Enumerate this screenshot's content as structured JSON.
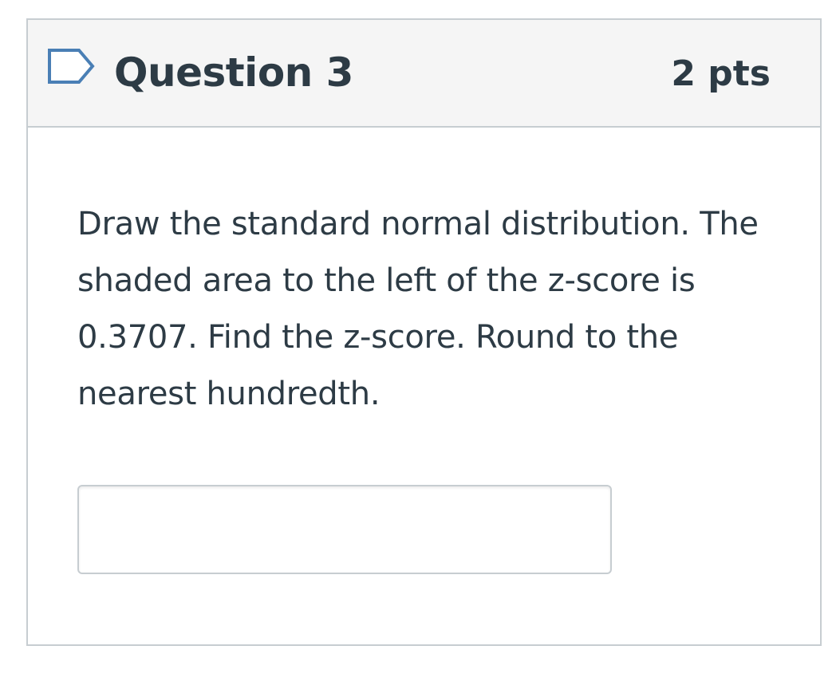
{
  "question": {
    "title": "Question 3",
    "points": "2 pts",
    "flag_icon": "bookmark-flag-icon",
    "text": "Draw the standard normal distribution. The shaded area to the left of the z-score is 0.3707. Find the z-score. Round to the nearest hundredth.",
    "answer_value": "",
    "colors": {
      "header_bg": "#f5f5f5",
      "border": "#c7cdd1",
      "text": "#2d3b45",
      "flag": "#4a7fb5"
    }
  }
}
